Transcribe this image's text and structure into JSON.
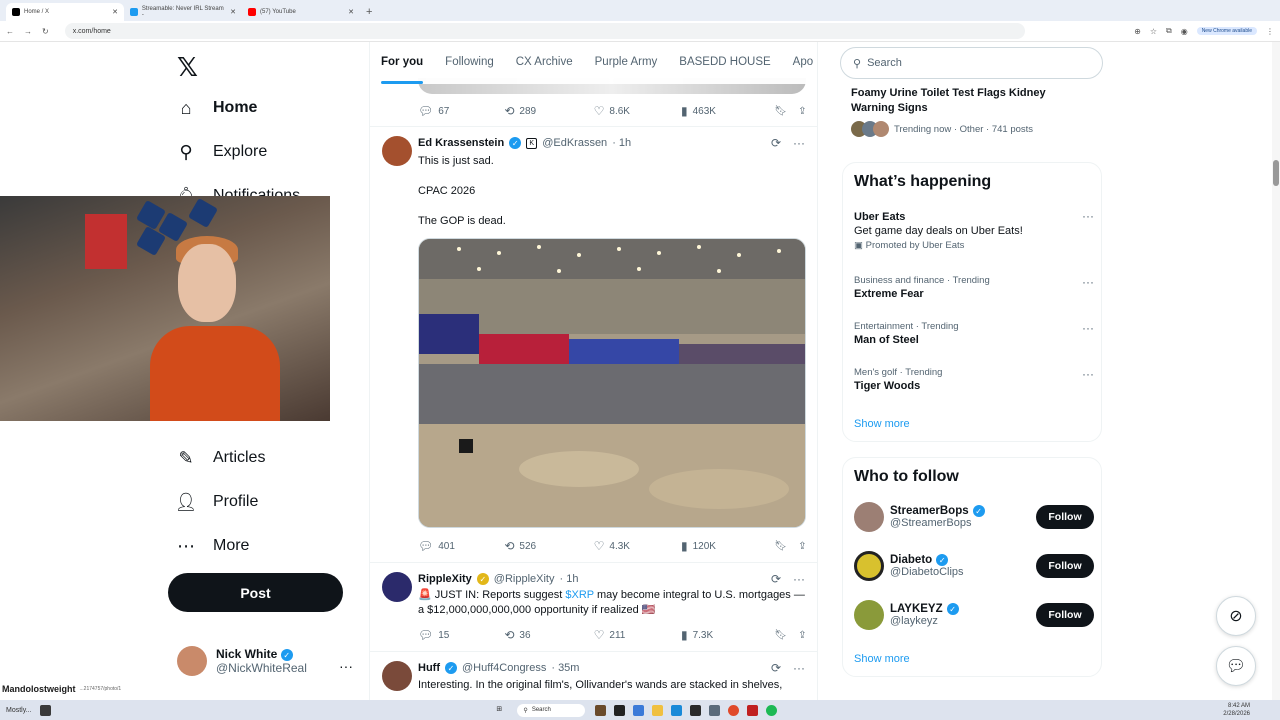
{
  "browser": {
    "tabs": [
      {
        "label": "Home / X",
        "active": true,
        "color": "#000000"
      },
      {
        "label": "Streamable: Never IRL Stream -",
        "active": false,
        "color": "#1d9bf0"
      },
      {
        "label": "(57) YouTube",
        "active": false,
        "color": "#ff0000"
      }
    ],
    "url": "x.com/home",
    "new_chrome": "New Chrome available"
  },
  "nav": {
    "home": "Home",
    "explore": "Explore",
    "notifications": "Notifications",
    "articles": "Articles",
    "profile": "Profile",
    "more": "More",
    "post": "Post"
  },
  "account": {
    "name": "Nick White",
    "handle": "@NickWhiteReal"
  },
  "feed_tabs": [
    "For you",
    "Following",
    "CX Archive",
    "Purple Army",
    "BASEDD HOUSE",
    "Apo"
  ],
  "prev_actions": {
    "replies": "67",
    "reposts": "289",
    "likes": "8.6K",
    "views": "463K"
  },
  "tweets": [
    {
      "name": "Ed Krassenstein",
      "handle": "@EdKrassen",
      "time": "· 1h",
      "lines": [
        "This is just sad.",
        "CPAC 2026",
        "The GOP is dead."
      ],
      "replies": "401",
      "reposts": "526",
      "likes": "4.3K",
      "views": "120K"
    },
    {
      "name": "RippleXity",
      "handle": "@RippleXity",
      "time": "· 1h",
      "pre": "JUST IN: Reports suggest ",
      "link": "$XRP",
      "post": " may become integral to U.S. mortgages — a $12,000,000,000,000 opportunity if realized",
      "replies": "15",
      "reposts": "36",
      "likes": "211",
      "views": "7.3K"
    },
    {
      "name": "Huff",
      "handle": "@Huff4Congress",
      "time": "· 35m",
      "text": "Interesting. In the original film's, Ollivander's wands are stacked in shelves,"
    }
  ],
  "search": {
    "placeholder": "Search"
  },
  "top_trend": {
    "title": "Foamy Urine Toilet Test Flags Kidney Warning Signs",
    "meta": "Trending now · Other · 741 posts"
  },
  "happening": {
    "title": "What’s happening",
    "items": [
      {
        "meta": "",
        "title": "Uber Eats",
        "desc": "Get game day deals on Uber Eats!",
        "promo": "Promoted by Uber Eats"
      },
      {
        "meta": "Business and finance · Trending",
        "title": "Extreme Fear"
      },
      {
        "meta": "Entertainment · Trending",
        "title": "Man of Steel"
      },
      {
        "meta": "Men's golf · Trending",
        "title": "Tiger Woods"
      }
    ],
    "show_more": "Show more"
  },
  "who_to_follow": {
    "title": "Who to follow",
    "accounts": [
      {
        "name": "StreamerBops",
        "handle": "@StreamerBops"
      },
      {
        "name": "Diabeto",
        "handle": "@DiabetoClips"
      },
      {
        "name": "LAYKEYZ",
        "handle": "@laykeyz"
      }
    ],
    "follow_label": "Follow",
    "show_more": "Show more"
  },
  "overlay": {
    "name": "Mandolostweight",
    "url": "...2174757/photo/1"
  },
  "taskbar": {
    "search": "Search",
    "time": "8:42 AM",
    "date": "2/28/2026",
    "widget": "Mostly..."
  },
  "colors": {
    "accent": "#1d9bf0",
    "text": "#0f1419",
    "muted": "#536471"
  }
}
